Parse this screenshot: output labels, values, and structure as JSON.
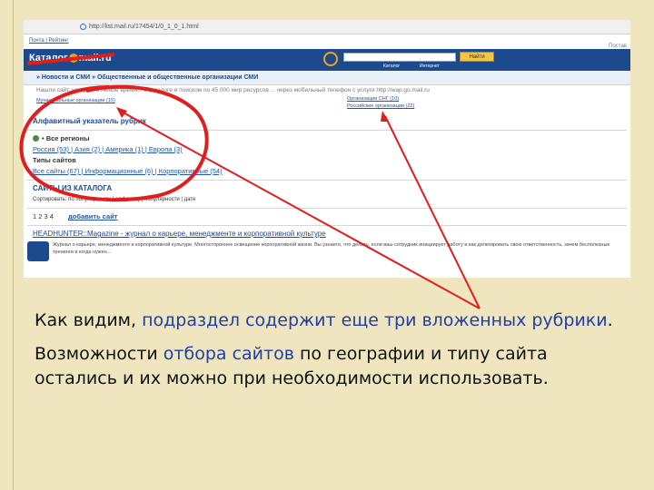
{
  "screenshot": {
    "address_url": "http://list.mail.ru/17454/1/0_1_0_1.html",
    "posted_label": "Постав",
    "top_links": "Почта  |  Рейтинг",
    "logo_text": "Каталог",
    "logo_domain": "mail.ru",
    "search_button": "Найти",
    "radio_catalog": "Каталог",
    "radio_internet": "Интернет",
    "breadcrumb": "» Новости и СМИ » Общественные и общественные организации СМИ",
    "info_line": "Нашли сайт, который в любое время... в каталоге и поиском по 45 000 мир ресурсов ... через мобильный телефон с услуги http://wap.go.mail.ru",
    "sublink_left": "Муниципальные организации (15)",
    "sublink_right_1": "Организации СНГ (10)",
    "sublink_right_2": "Российские организации (22)",
    "alpha_index": "Алфавитный указатель рубрик",
    "regions_title": "• Все регионы",
    "regions_list": "Россия (53)  |  Азия (2)  |  Америка (1)  |  Европа (3)",
    "site_types_title": "Типы сайтов",
    "site_types_list": "Все сайты (67)  |  Информационные (6)  |  Корпоративные (54)",
    "catalog_sites_title": "САЙТЫ ИЗ КАТАЛОГА",
    "sort_label": "Сортировать: по популярности  |  алфавиту  |  популярности  |  дате",
    "pages": "1 2 3 4",
    "add_site": "добавить сайт",
    "hh_title": "HEADHUNTER::Magazine - журнал о карьере, менеджменте и корпоративной культуре",
    "hh_desc": "Журнал о карьере, менеджменте и корпоративной культуре. Многостороннее освещение корпоративной жизни. Вы узнаете, что делать, если ваш сотрудник инициирует работу и как делегировать свою ответственность, зачем бесполезные тренинги и когда нужен..."
  },
  "caption": {
    "p1_a": "Как видим, ",
    "p1_b": "подраздел содержит еще три вложенных рубрики",
    "p1_c": ".",
    "p2_a": "Возможности ",
    "p2_b": "отбора сайтов",
    "p2_c": " по географии и типу сайта остались и их можно при необходимости использовать."
  },
  "colors": {
    "slide_bg": "#efe6bf",
    "accent_text": "#1f3fa8",
    "annotation_red": "#e01e1e",
    "header_blue": "#1d4a8c"
  }
}
